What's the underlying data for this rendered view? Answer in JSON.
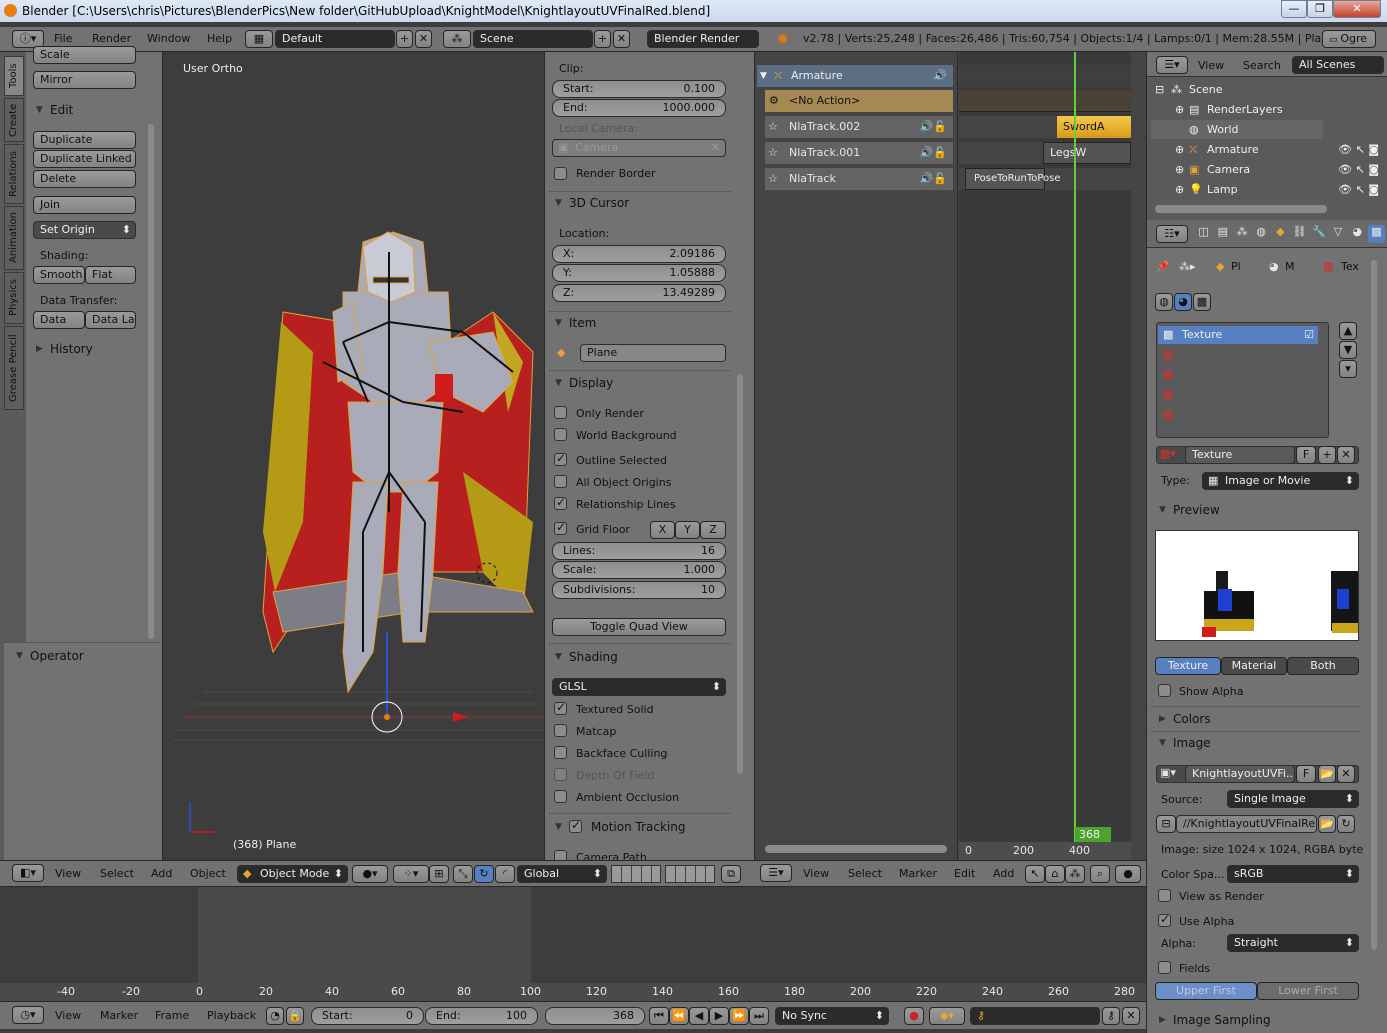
{
  "window": {
    "title": "Blender [C:\\Users\\chris\\Pictures\\BlenderPics\\New folder\\GitHubUpload\\KnightModel\\KnightlayoutUVFinalRed.blend]"
  },
  "menubar": {
    "items": [
      "File",
      "Render",
      "Window",
      "Help"
    ],
    "layout": "Default",
    "scene": "Scene",
    "engine": "Blender Render",
    "stats": "v2.78 | Verts:25,248 | Faces:26,486 | Tris:60,754 | Objects:1/4 | Lamps:0/1 | Mem:28.55M | Plane",
    "ogre": "Ogre"
  },
  "tools": {
    "tabs": [
      "Tools",
      "Create",
      "Relations",
      "Animation",
      "Physics",
      "Grease Pencil"
    ],
    "scale": "Scale",
    "mirror": "Mirror",
    "edit_header": "Edit",
    "duplicate": "Duplicate",
    "duplicate_linked": "Duplicate Linked",
    "delete": "Delete",
    "join": "Join",
    "set_origin": "Set Origin",
    "shading_label": "Shading:",
    "smooth": "Smooth",
    "flat": "Flat",
    "data_transfer_label": "Data Transfer:",
    "data": "Data",
    "data_la": "Data La",
    "history": "History",
    "operator": "Operator"
  },
  "viewport": {
    "view_name": "User Ortho",
    "object_label": "(368) Plane"
  },
  "properties": {
    "clip": "Clip:",
    "start_label": "Start:",
    "start_val": "0.100",
    "end_label": "End:",
    "end_val": "1000.000",
    "local_camera": "Local Camera:",
    "camera": "Camera",
    "render_border": "Render Border",
    "cursor_header": "3D Cursor",
    "location": "Location:",
    "x_label": "X:",
    "x_val": "2.09186",
    "y_label": "Y:",
    "y_val": "1.05888",
    "z_label": "Z:",
    "z_val": "13.49289",
    "item_header": "Item",
    "item_name": "Plane",
    "display_header": "Display",
    "only_render": "Only Render",
    "world_background": "World Background",
    "outline_selected": "Outline Selected",
    "all_object_origins": "All Object Origins",
    "relationship_lines": "Relationship Lines",
    "grid_floor": "Grid Floor",
    "gx": "X",
    "gy": "Y",
    "gz": "Z",
    "lines_label": "Lines:",
    "lines_val": "16",
    "scale_label": "Scale:",
    "scale_val": "1.000",
    "subdiv_label": "Subdivisions:",
    "subdiv_val": "10",
    "toggle_quad": "Toggle Quad View",
    "shading_header": "Shading",
    "glsl": "GLSL",
    "textured_solid": "Textured Solid",
    "matcap": "Matcap",
    "backface_culling": "Backface Culling",
    "depth_of_field": "Depth Of Field",
    "ambient_occlusion": "Ambient Occlusion",
    "motion_tracking": "Motion Tracking",
    "camera_path": "Camera Path"
  },
  "view3d_header": {
    "view": "View",
    "select": "Select",
    "add": "Add",
    "object": "Object",
    "mode": "Object Mode",
    "orientation": "Global"
  },
  "nla": {
    "tracks": [
      "Armature",
      "<No Action>",
      "NlaTrack.002",
      "NlaTrack.001",
      "NlaTrack"
    ],
    "strips": [
      "SwordA",
      "LegsW",
      "PoseToRunToPose"
    ],
    "frame": "368",
    "ticks": [
      "0",
      "200",
      "400"
    ],
    "menu": [
      "View",
      "Select",
      "Marker",
      "Edit",
      "Add"
    ]
  },
  "outliner": {
    "menu": [
      "View",
      "Search"
    ],
    "filter": "All Scenes",
    "items": [
      "Scene",
      "RenderLayers",
      "World",
      "Armature",
      "Camera",
      "Lamp"
    ]
  },
  "texture": {
    "breadcrumbs": [
      "Pl",
      "M",
      "Tex"
    ],
    "slot": "Texture",
    "name": "Texture",
    "f": "F",
    "type_label": "Type:",
    "type_val": "Image or Movie",
    "preview_header": "Preview",
    "tabs": [
      "Texture",
      "Material",
      "Both"
    ],
    "show_alpha": "Show Alpha",
    "colors_header": "Colors",
    "image_header": "Image",
    "image_name": "KnightlayoutUVFi...",
    "source_label": "Source:",
    "source_val": "Single Image",
    "path": "//KnightlayoutUVFinalRe...",
    "image_info": "Image: size 1024 x 1024, RGBA byte",
    "view_as_render": "View as Render",
    "color_space_label": "Color Spa...",
    "color_space_val": "sRGB",
    "use_alpha": "Use Alpha",
    "alpha_label": "Alpha:",
    "alpha_val": "Straight",
    "fields": "Fields",
    "upper_first": "Upper First",
    "lower_first": "Lower First",
    "image_sampling": "Image Sampling"
  },
  "timeline": {
    "ticks": [
      "-40",
      "-20",
      "0",
      "20",
      "40",
      "60",
      "80",
      "100",
      "120",
      "140",
      "160",
      "180",
      "200",
      "220",
      "240",
      "260",
      "280"
    ],
    "menu": [
      "View",
      "Marker",
      "Frame",
      "Playback"
    ],
    "start_label": "Start:",
    "start_val": "0",
    "end_label": "End:",
    "end_val": "100",
    "current": "368",
    "sync": "No Sync"
  }
}
